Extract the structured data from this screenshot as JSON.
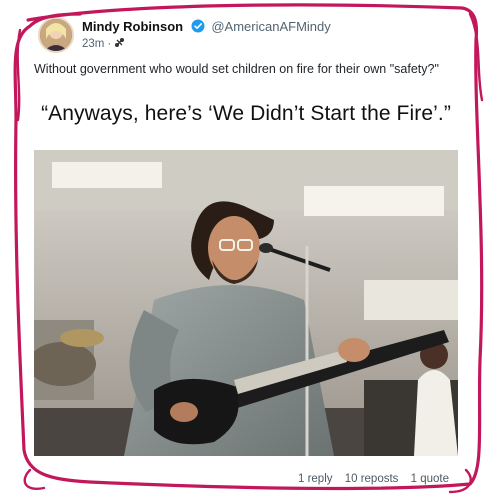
{
  "post": {
    "author_name": "Mindy Robinson",
    "handle": "@AmericanAFMindy",
    "time": "23m",
    "text": "Without government who would set children on fire for their own \"safety?\""
  },
  "meme": {
    "caption": "“Anyways, here’s ‘We Didn’t Start the Fire’.”"
  },
  "stats": {
    "replies": "1 reply",
    "reposts": "10 reposts",
    "quotes": "1 quote"
  },
  "colors": {
    "scribble": "#c2185b",
    "verified": "#1d9bf0"
  },
  "icons": [
    "verified-badge-icon",
    "fediverse-icon"
  ]
}
